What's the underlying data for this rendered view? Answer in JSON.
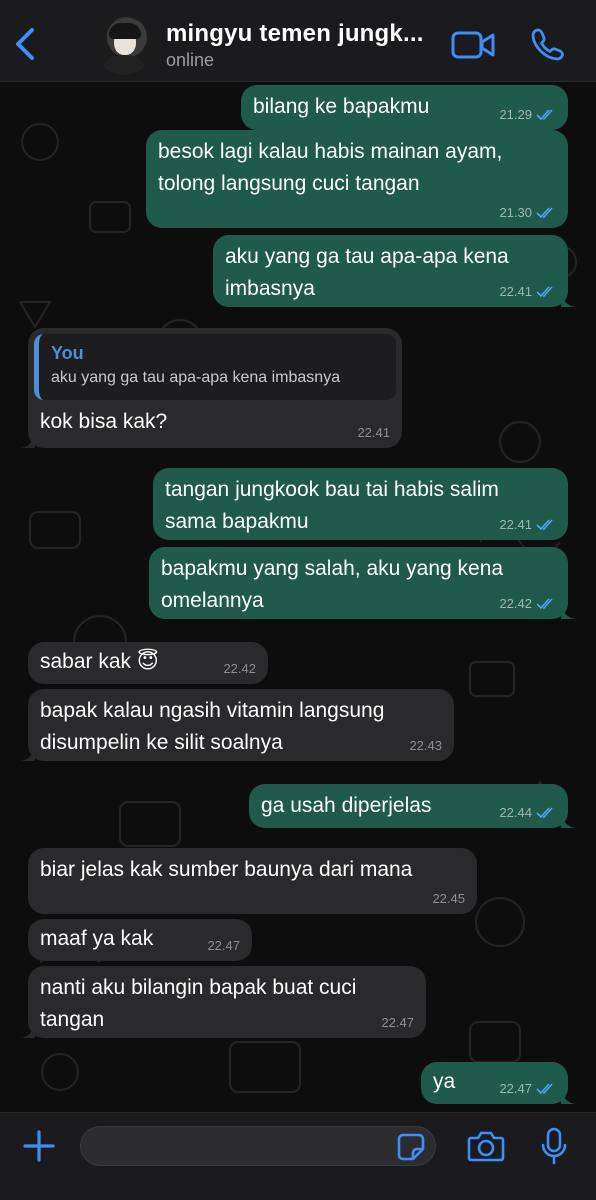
{
  "header": {
    "contact_name": "mingyu temen jungk...",
    "status": "online"
  },
  "messages": [
    {
      "id": "m1",
      "dir": "out",
      "text": "bilang ke bapakmu",
      "time": "21.29",
      "read": true
    },
    {
      "id": "m2",
      "dir": "out",
      "text": "besok lagi kalau habis mainan ayam,\ntolong langsung cuci tangan",
      "time": "21.30",
      "read": true
    },
    {
      "id": "m3",
      "dir": "out",
      "text": "aku yang ga tau apa-apa kena\nimbasnya",
      "time": "22.41",
      "read": true
    },
    {
      "id": "m4",
      "dir": "in",
      "text": "kok bisa kak?",
      "time": "22.41",
      "reply_to": {
        "author": "You",
        "text": "aku yang ga tau apa-apa kena imbasnya"
      }
    },
    {
      "id": "m5",
      "dir": "out",
      "text": "tangan jungkook bau tai habis salim\nsama bapakmu",
      "time": "22.41",
      "read": true
    },
    {
      "id": "m6",
      "dir": "out",
      "text": "bapakmu yang salah, aku yang kena\nomelannya",
      "time": "22.42",
      "read": true
    },
    {
      "id": "m7",
      "dir": "in",
      "text": "sabar kak 😇",
      "time": "22.42"
    },
    {
      "id": "m8",
      "dir": "in",
      "text": "bapak kalau ngasih vitamin langsung\ndisumpelin ke silit soalnya",
      "time": "22.43"
    },
    {
      "id": "m9",
      "dir": "out",
      "text": "ga usah diperjelas",
      "time": "22.44",
      "read": true
    },
    {
      "id": "m10",
      "dir": "in",
      "text": "biar jelas kak sumber baunya dari mana",
      "time": "22.45"
    },
    {
      "id": "m11",
      "dir": "in",
      "text": "maaf ya kak",
      "time": "22.47"
    },
    {
      "id": "m12",
      "dir": "in",
      "text": "nanti aku bilangin bapak buat cuci\ntangan",
      "time": "22.47"
    },
    {
      "id": "m13",
      "dir": "out",
      "text": "ya",
      "time": "22.47",
      "read": true
    }
  ],
  "composer": {
    "placeholder": ""
  },
  "icons": {
    "back": "chevron-left-icon",
    "video": "video-camera-icon",
    "call": "phone-icon",
    "attach": "plus-icon",
    "sticker": "sticker-icon",
    "camera": "camera-icon",
    "mic": "microphone-icon"
  },
  "colors": {
    "accent": "#3d8ef7",
    "outgoing_bubble": "#1f5a4a",
    "incoming_bubble": "#2a2a2c",
    "read_ticks": "#4fa3f7",
    "quote_accent": "#4e8ed1"
  }
}
